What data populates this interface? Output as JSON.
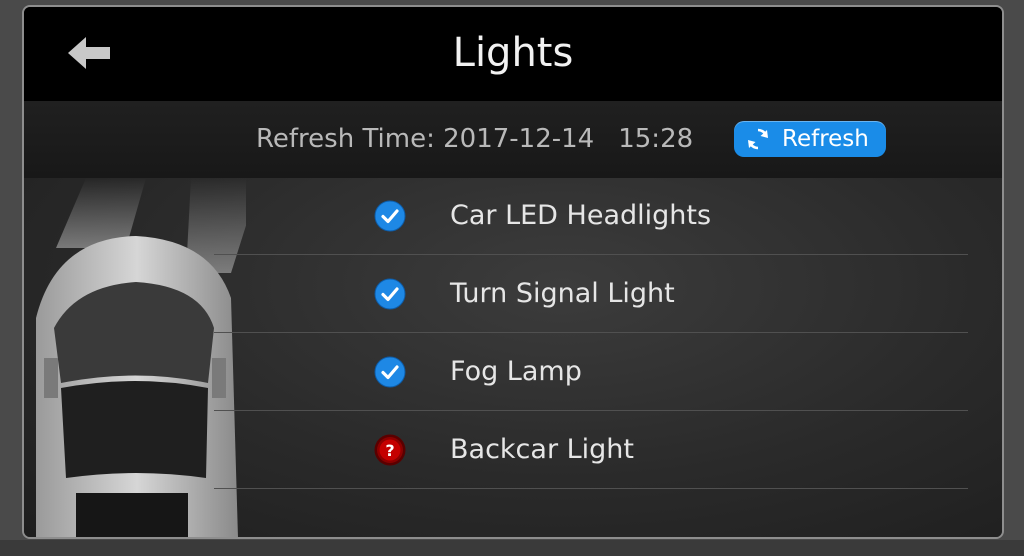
{
  "header": {
    "title": "Lights",
    "back_icon": "arrow-left-icon"
  },
  "refresh": {
    "label": "Refresh Time:",
    "date": "2017-12-14",
    "time": "15:28",
    "button_label": "Refresh",
    "button_icon": "refresh-icon",
    "button_color": "#1a8ce8"
  },
  "lights": [
    {
      "label": "Car LED Headlights",
      "status": "ok",
      "icon": "check-circle-icon"
    },
    {
      "label": "Turn Signal Light",
      "status": "ok",
      "icon": "check-circle-icon"
    },
    {
      "label": "Fog Lamp",
      "status": "ok",
      "icon": "check-circle-icon"
    },
    {
      "label": "Backcar Light",
      "status": "unknown",
      "icon": "question-circle-icon"
    }
  ],
  "colors": {
    "ok": "#1e88e5",
    "unknown": "#b00000",
    "header_bg": "#000000"
  }
}
